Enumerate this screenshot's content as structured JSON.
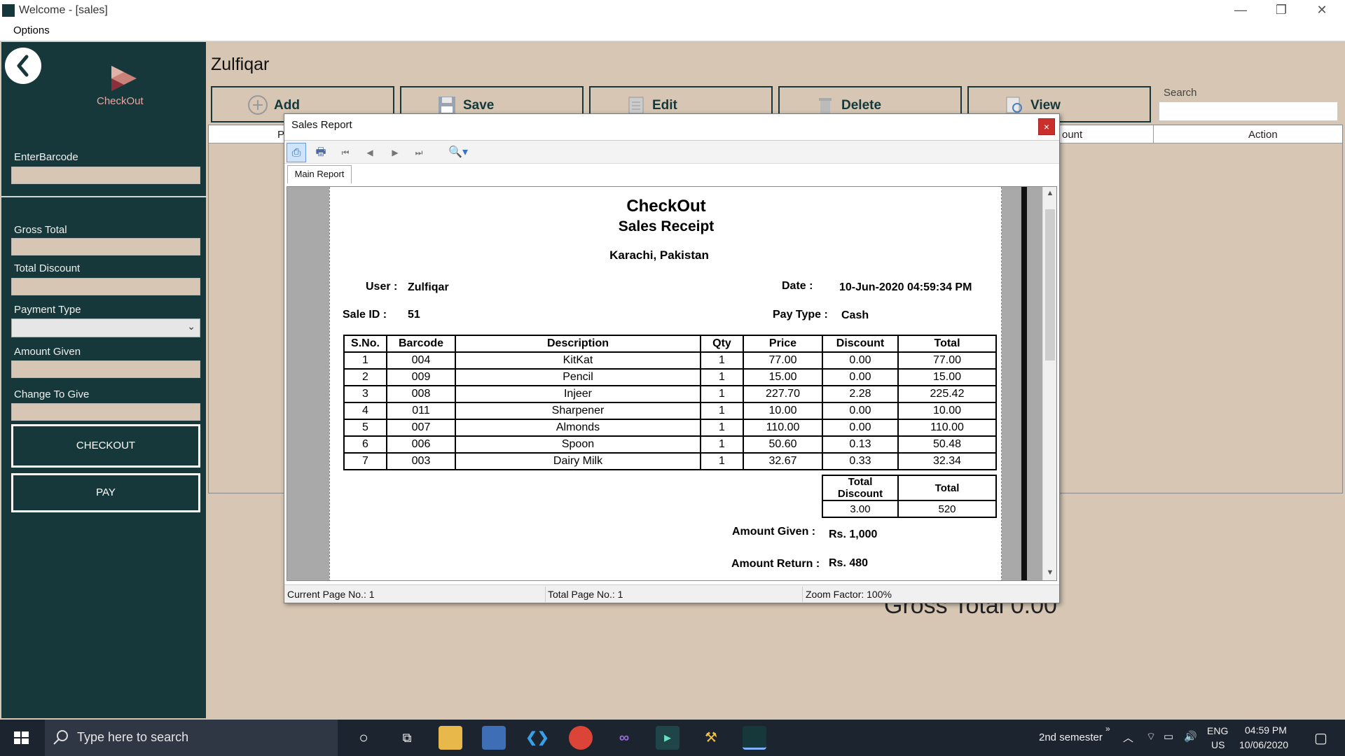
{
  "window": {
    "title": "Welcome - [sales]",
    "controls": {
      "minimize": "—",
      "restore": "❐",
      "close": "✕"
    }
  },
  "menu": {
    "options_label": "Options"
  },
  "sidebar": {
    "logo_text": "CheckOut",
    "back_icon": "back-arrow-icon",
    "barcode_label": "EnterBarcode",
    "gross_total_label": "Gross Total",
    "total_discount_label": "Total Discount",
    "payment_type_label": "Payment Type",
    "amount_given_label": "Amount Given",
    "change_label": "Change To Give",
    "checkout_label": "CHECKOUT",
    "pay_label": "PAY"
  },
  "main": {
    "username": "Zulfiqar",
    "toolbar": {
      "add_label": "Add",
      "save_label": "Save",
      "edit_label": "Edit",
      "delete_label": "Delete",
      "view_label": "View"
    },
    "search_label": "Search",
    "grid_headers": {
      "first": "P",
      "amount_partial": "ount",
      "action": "Action"
    },
    "gross_total_big": "Gross Total   0.00"
  },
  "report_dialog": {
    "title": "Sales Report",
    "close_label": "×",
    "tab_label": "Main Report",
    "toolbar_icons": [
      "page-setup-icon",
      "print-icon",
      "first-page-icon",
      "prev-page-icon",
      "next-page-icon",
      "last-page-icon",
      "zoom-icon"
    ],
    "status": {
      "current_page": "Current Page No.: 1",
      "total_pages": "Total Page No.: 1",
      "zoom": "Zoom Factor: 100%"
    },
    "receipt": {
      "company": "CheckOut",
      "doc_title": "Sales Receipt",
      "location": "Karachi, Pakistan",
      "user_label": "User :",
      "user_value": "Zulfiqar",
      "date_label": "Date  :",
      "date_value": "10-Jun-2020 04:59:34 PM",
      "sale_id_label": "Sale ID :",
      "sale_id_value": "51",
      "pay_type_label": "Pay Type :",
      "pay_type_value": "Cash",
      "headers": [
        "S.No.",
        "Barcode",
        "Description",
        "Qty",
        "Price",
        "Discount",
        "Total"
      ],
      "rows": [
        [
          "1",
          "004",
          "KitKat",
          "1",
          "77.00",
          "0.00",
          "77.00"
        ],
        [
          "2",
          "009",
          "Pencil",
          "1",
          "15.00",
          "0.00",
          "15.00"
        ],
        [
          "3",
          "008",
          "Injeer",
          "1",
          "227.70",
          "2.28",
          "225.42"
        ],
        [
          "4",
          "011",
          "Sharpener",
          "1",
          "10.00",
          "0.00",
          "10.00"
        ],
        [
          "5",
          "007",
          "Almonds",
          "1",
          "110.00",
          "0.00",
          "110.00"
        ],
        [
          "6",
          "006",
          "Spoon",
          "1",
          "50.60",
          "0.13",
          "50.48"
        ],
        [
          "7",
          "003",
          "Dairy Milk",
          "1",
          "32.67",
          "0.33",
          "32.34"
        ]
      ],
      "summary_headers": [
        "Total Discount",
        "Total"
      ],
      "summary_values": [
        "3.00",
        "520"
      ],
      "amount_given_label": "Amount Given :",
      "amount_given_value": "Rs. 1,000",
      "amount_return_label": "Amount Return :",
      "amount_return_value": "Rs. 480"
    }
  },
  "taskbar": {
    "search_placeholder": "Type here to search",
    "tray_label": "2nd semester",
    "language_top": "ENG",
    "language_bottom": "US",
    "time": "04:59 PM",
    "date": "10/06/2020"
  }
}
